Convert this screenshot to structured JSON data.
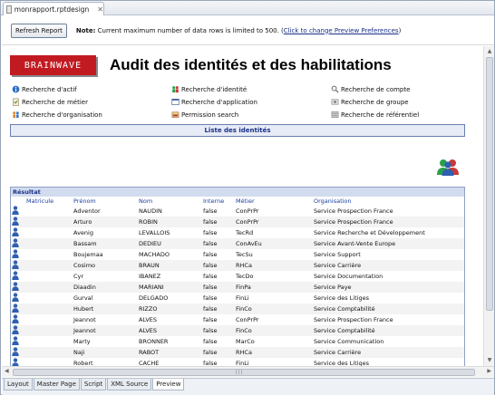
{
  "editor_tab": {
    "title": "monrapport.rptdesign"
  },
  "toolbar": {
    "refresh_label": "Refresh Report",
    "note_label": "Note:",
    "note_text": "Current maximum number of data rows is limited to 500. (",
    "note_link": "Click to change Preview Preferences",
    "note_end": ")"
  },
  "report": {
    "logo_text": "BRAINWAVE",
    "title": "Audit des identités et des habilitations",
    "links": {
      "col1": [
        "Recherche d'actif",
        "Recherche de métier",
        "Recherche d'organisation"
      ],
      "col2": [
        "Recherche d'identité",
        "Recherche d'application",
        "Permission search"
      ],
      "col3": [
        "Recherche de compte",
        "Recherche de groupe",
        "Recherche de référentiel"
      ]
    },
    "liste_label": "Liste des identités",
    "result_title": "Résultat",
    "columns": [
      "Matricule",
      "Prénom",
      "Nom",
      "Interne",
      "Métier",
      "Organisation"
    ],
    "rows": [
      [
        "",
        "Adventor",
        "NAUDIN",
        "false",
        "ConPrPr",
        "Service Prospection France"
      ],
      [
        "",
        "Arturo",
        "ROBIN",
        "false",
        "ConPrPr",
        "Service Prospection France"
      ],
      [
        "",
        "Avenig",
        "LEVALLOIS",
        "false",
        "TecRd",
        "Service Recherche et Développement"
      ],
      [
        "",
        "Bassam",
        "DEDIEU",
        "false",
        "ConAvEu",
        "Service Avant-Vente Europe"
      ],
      [
        "",
        "Boujemaa",
        "MACHADO",
        "false",
        "TecSu",
        "Service Support"
      ],
      [
        "",
        "Cosimo",
        "BRAUN",
        "false",
        "RHCa",
        "Service Carrière"
      ],
      [
        "",
        "Cyr",
        "IBANEZ",
        "false",
        "TecDo",
        "Service Documentation"
      ],
      [
        "",
        "Diaadin",
        "MARIANI",
        "false",
        "FinPa",
        "Service Paye"
      ],
      [
        "",
        "Gurval",
        "DELGADO",
        "false",
        "FinLi",
        "Service des Litiges"
      ],
      [
        "",
        "Hubert",
        "RIZZO",
        "false",
        "FinCo",
        "Service Comptabilité"
      ],
      [
        "",
        "Jeannot",
        "ALVES",
        "false",
        "ConPrPr",
        "Service Prospection France"
      ],
      [
        "",
        "Jeannot",
        "ALVES",
        "false",
        "FinCo",
        "Service Comptabilité"
      ],
      [
        "",
        "Marty",
        "BRONNER",
        "false",
        "MarCo",
        "Service Communication"
      ],
      [
        "",
        "Naji",
        "RABOT",
        "false",
        "RHCa",
        "Service Carrière"
      ],
      [
        "",
        "Robert",
        "CACHE",
        "false",
        "FinLi",
        "Service des Litiges"
      ]
    ]
  },
  "bottom_tabs": [
    "Layout",
    "Master Page",
    "Script",
    "XML Source",
    "Preview"
  ],
  "active_bottom_tab": "Preview",
  "colors": {
    "logo": "#c21a21",
    "link_blue": "#1a2f8a",
    "header_blue": "#1a3ea0"
  }
}
